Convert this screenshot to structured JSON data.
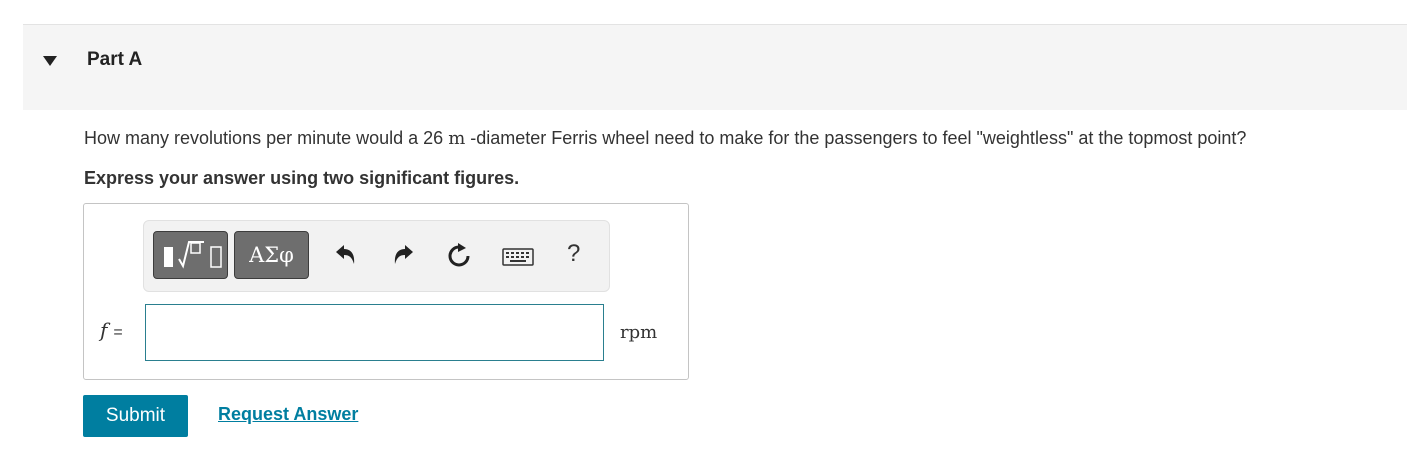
{
  "part": {
    "title": "Part A"
  },
  "question": {
    "text_before": "How many revolutions per minute would a 26 ",
    "unit": "m",
    "text_after": " -diameter Ferris wheel need to make for the passengers to feel \"weightless\" at the topmost point?",
    "instruction": "Express your answer using two significant figures."
  },
  "toolbar": {
    "symbols_label": "ΑΣφ",
    "help_label": "?",
    "icons": [
      "templates-icon",
      "undo-icon",
      "redo-icon",
      "reset-icon",
      "keyboard-icon",
      "help-icon"
    ]
  },
  "answer": {
    "variable": "f",
    "equals": "=",
    "value": "",
    "unit": "rpm"
  },
  "actions": {
    "submit_label": "Submit",
    "request_label": "Request Answer"
  },
  "colors": {
    "accent": "#007ea0",
    "header_bg": "#f5f5f5",
    "toolbar_button": "#6e6e6e"
  }
}
